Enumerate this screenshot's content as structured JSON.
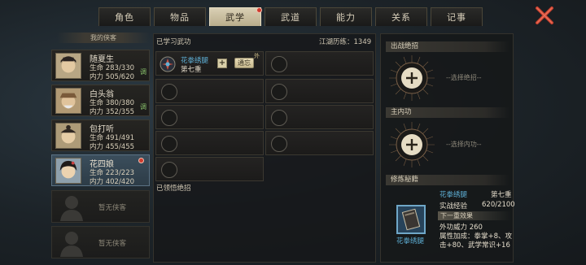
{
  "tabs": [
    {
      "label": "角色",
      "active": false
    },
    {
      "label": "物品",
      "active": false
    },
    {
      "label": "武学",
      "active": true,
      "has_badge": true
    },
    {
      "label": "武道",
      "active": false
    },
    {
      "label": "能力",
      "active": false
    },
    {
      "label": "关系",
      "active": false
    },
    {
      "label": "记事",
      "active": false
    }
  ],
  "close_icon": "close-x-icon",
  "party": {
    "title": "我的侠客",
    "members": [
      {
        "name": "随夏生",
        "hp_label": "生命",
        "hp": "283/330",
        "mp_label": "内力",
        "mp": "505/620",
        "tag": "调",
        "selected": false,
        "badge": false
      },
      {
        "name": "白头翁",
        "hp_label": "生命",
        "hp": "380/380",
        "mp_label": "内力",
        "mp": "352/355",
        "tag": "调",
        "selected": false,
        "badge": false
      },
      {
        "name": "包打听",
        "hp_label": "生命",
        "hp": "491/491",
        "mp_label": "内力",
        "mp": "455/455",
        "tag": "",
        "selected": false,
        "badge": false
      },
      {
        "name": "花四娘",
        "hp_label": "生命",
        "hp": "223/223",
        "mp_label": "内力",
        "mp": "402/420",
        "tag": "",
        "selected": true,
        "badge": true
      }
    ],
    "empty_label": "暂无侠客"
  },
  "learned": {
    "header": "已学习武功",
    "exp_label": "江湖历练：1349",
    "first": {
      "name": "花拳绣腿",
      "level": "第七重",
      "add_symbol": "+",
      "tong_label": "通忘",
      "wai_label": "外"
    },
    "footer": "已领悟绝招"
  },
  "ultimate": {
    "header": "出战绝招",
    "placeholder": "--选择绝招--",
    "plus": "+"
  },
  "inner": {
    "header": "主内功",
    "placeholder": "--选择内功--",
    "plus": "+"
  },
  "book": {
    "header": "修炼秘籍",
    "name": "花拳绣腿",
    "level": "第七重",
    "exp_label": "实战经验",
    "exp_value": "620/2100",
    "next_label": "下一重效果",
    "effect_1": "外功威力 260",
    "effect_2": "属性加成：拳掌+8、攻",
    "effect_3": "击+80、武学常识+16",
    "caption": "花拳绣腿"
  },
  "colors": {
    "accent_blue": "#5fb1d8",
    "tab_active": "#d9cfb4",
    "badge_red": "#d03a2c",
    "tag_green": "#8ac36c"
  }
}
